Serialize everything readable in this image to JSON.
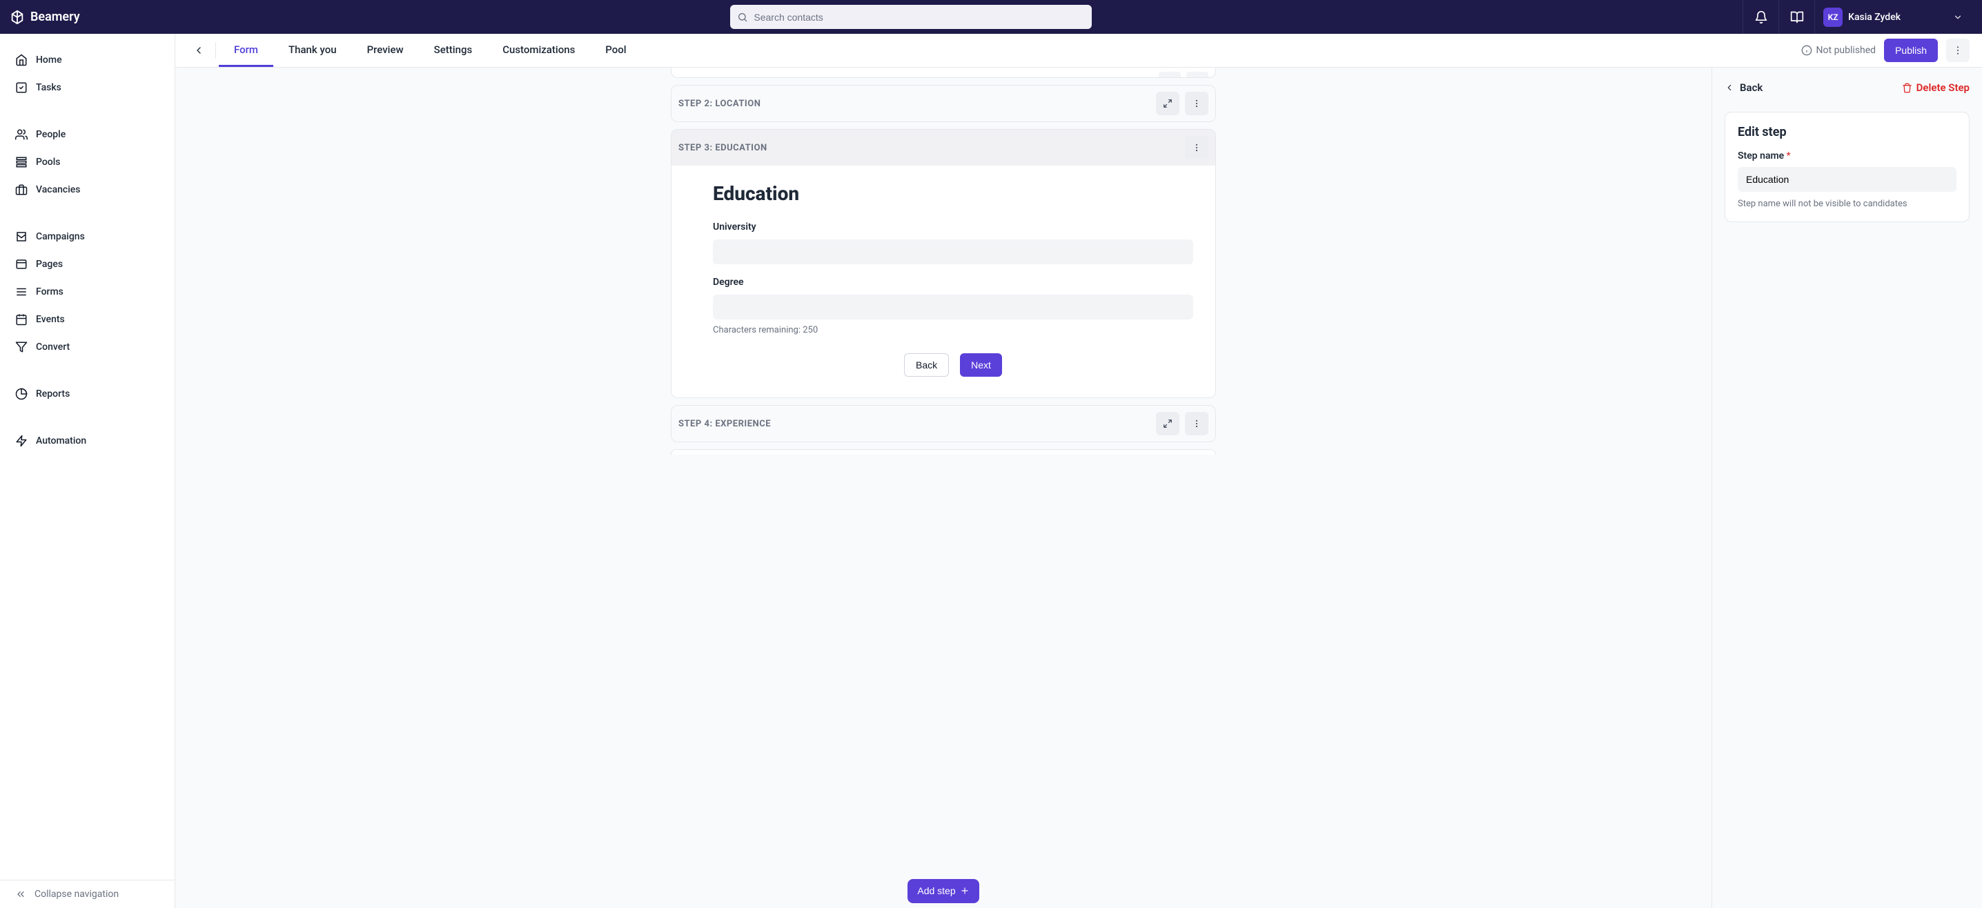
{
  "brand": {
    "name": "Beamery"
  },
  "search": {
    "placeholder": "Search contacts"
  },
  "user": {
    "initials": "KZ",
    "name": "Kasia Zydek"
  },
  "sidebar": {
    "items": [
      {
        "label": "Home"
      },
      {
        "label": "Tasks"
      },
      {
        "label": "People"
      },
      {
        "label": "Pools"
      },
      {
        "label": "Vacancies"
      },
      {
        "label": "Campaigns"
      },
      {
        "label": "Pages"
      },
      {
        "label": "Forms"
      },
      {
        "label": "Events"
      },
      {
        "label": "Convert"
      },
      {
        "label": "Reports"
      },
      {
        "label": "Automation"
      }
    ],
    "collapse_label": "Collapse navigation"
  },
  "tabs": {
    "items": [
      {
        "label": "Form",
        "active": true
      },
      {
        "label": "Thank you",
        "active": false
      },
      {
        "label": "Preview",
        "active": false
      },
      {
        "label": "Settings",
        "active": false
      },
      {
        "label": "Customizations",
        "active": false
      },
      {
        "label": "Pool",
        "active": false
      }
    ]
  },
  "status_text": "Not published",
  "publish_label": "Publish",
  "steps": {
    "step2": {
      "title": "STEP 2: LOCATION"
    },
    "step3": {
      "title": "STEP 3: EDUCATION",
      "heading": "Education",
      "field_university_label": "University",
      "field_degree_label": "Degree",
      "char_helper": "Characters remaining: 250",
      "back_label": "Back",
      "next_label": "Next"
    },
    "step4": {
      "title": "STEP 4: EXPERIENCE"
    }
  },
  "add_step_label": "Add step",
  "panel": {
    "back_label": "Back",
    "delete_label": "Delete Step",
    "title": "Edit step",
    "name_label": "Step name",
    "name_value": "Education",
    "helper": "Step name will not be visible to candidates"
  }
}
